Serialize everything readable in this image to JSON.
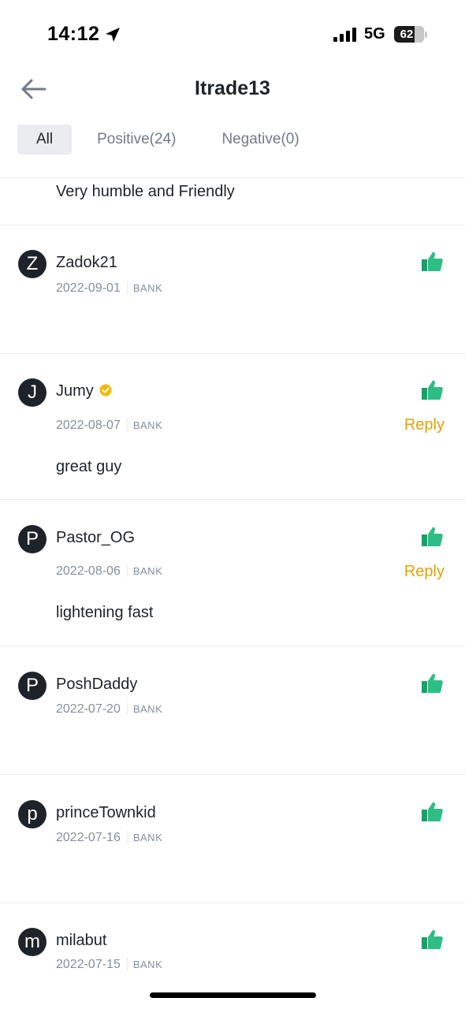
{
  "status_bar": {
    "time": "14:12",
    "network": "5G",
    "battery": "62"
  },
  "header": {
    "title": "Itrade13"
  },
  "tabs": [
    {
      "label": "All"
    },
    {
      "label": "Positive(24)"
    },
    {
      "label": "Negative(0)"
    }
  ],
  "partial_comment": "Very humble and Friendly",
  "reviews": [
    {
      "initial": "Z",
      "username": "Zadok21",
      "date": "2022-09-01",
      "method": "BANK",
      "reply": "",
      "comment": ""
    },
    {
      "initial": "J",
      "username": "Jumy",
      "date": "2022-08-07",
      "method": "BANK",
      "reply": "Reply",
      "comment": "great guy"
    },
    {
      "initial": "P",
      "username": "Pastor_OG",
      "date": "2022-08-06",
      "method": "BANK",
      "reply": "Reply",
      "comment": "lightening fast"
    },
    {
      "initial": "P",
      "username": "PoshDaddy",
      "date": "2022-07-20",
      "method": "BANK",
      "reply": "",
      "comment": ""
    },
    {
      "initial": "p",
      "username": "princeTownkid",
      "date": "2022-07-16",
      "method": "BANK",
      "reply": "",
      "comment": ""
    },
    {
      "initial": "m",
      "username": "milabut",
      "date": "2022-07-15",
      "method": "BANK",
      "reply": "",
      "comment": ""
    }
  ],
  "colors": {
    "positive": "#2ebd85",
    "reply": "#e0a10a",
    "verified": "#f0b90b",
    "text": "#1e2329",
    "muted": "#848e9c"
  },
  "icons": {
    "back": "arrow-left-icon",
    "thumb": "thumbs-up-icon",
    "verified": "verified-badge-icon",
    "location": "location-arrow-icon",
    "signal": "cellular-signal-icon"
  }
}
